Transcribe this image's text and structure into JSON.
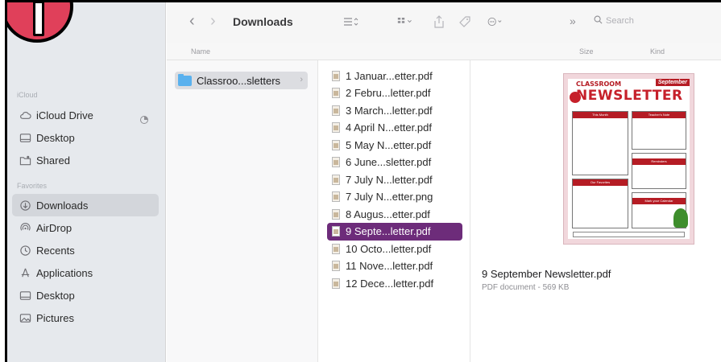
{
  "toolbar": {
    "back": "‹",
    "forward": "›",
    "title": "Downloads",
    "search_placeholder": "Search",
    "more": "»"
  },
  "columns_header": {
    "name": "Name",
    "size": "Size",
    "kind": "Kind"
  },
  "sidebar": {
    "sections": [
      {
        "header": "iCloud",
        "items": [
          {
            "label": "iCloud Drive",
            "icon": "cloud-icon"
          },
          {
            "label": "Desktop",
            "icon": "desktop-icon"
          },
          {
            "label": "Shared",
            "icon": "shared-folder-icon"
          }
        ]
      },
      {
        "header": "Favorites",
        "items": [
          {
            "label": "Downloads",
            "icon": "download-icon",
            "active": true
          },
          {
            "label": "AirDrop",
            "icon": "airdrop-icon"
          },
          {
            "label": "Recents",
            "icon": "clock-icon"
          },
          {
            "label": "Applications",
            "icon": "applications-icon"
          },
          {
            "label": "Desktop",
            "icon": "desktop-icon"
          },
          {
            "label": "Pictures",
            "icon": "pictures-icon"
          }
        ]
      }
    ]
  },
  "folder": {
    "label": "Classroo...sletters"
  },
  "files": [
    "1 Januar...etter.pdf",
    "2 Febru...letter.pdf",
    "3 March...letter.pdf",
    "4 April N...etter.pdf",
    "5 May N...etter.pdf",
    "6 June...sletter.pdf",
    "7 July N...letter.pdf",
    "7 July N...etter.png",
    "8 Augus...etter.pdf",
    "9 Septe...letter.pdf",
    "10 Octo...letter.pdf",
    "11 Nove...letter.pdf",
    "12 Dece...letter.pdf"
  ],
  "selected_index": 9,
  "preview": {
    "filename": "9 September Newsletter.pdf",
    "meta": "PDF document - 569 KB",
    "thumb": {
      "tag": "September",
      "small": "CLASSROOM",
      "big": "NEWSLETTER",
      "box1": "This Month",
      "box2": "Teacher's Note",
      "box3": "Reminders",
      "box4": "Our Favorites",
      "box5": "Mark your Calendar"
    }
  },
  "colors": {
    "accent": "#6d2c7a",
    "badge": "#e0405a"
  }
}
